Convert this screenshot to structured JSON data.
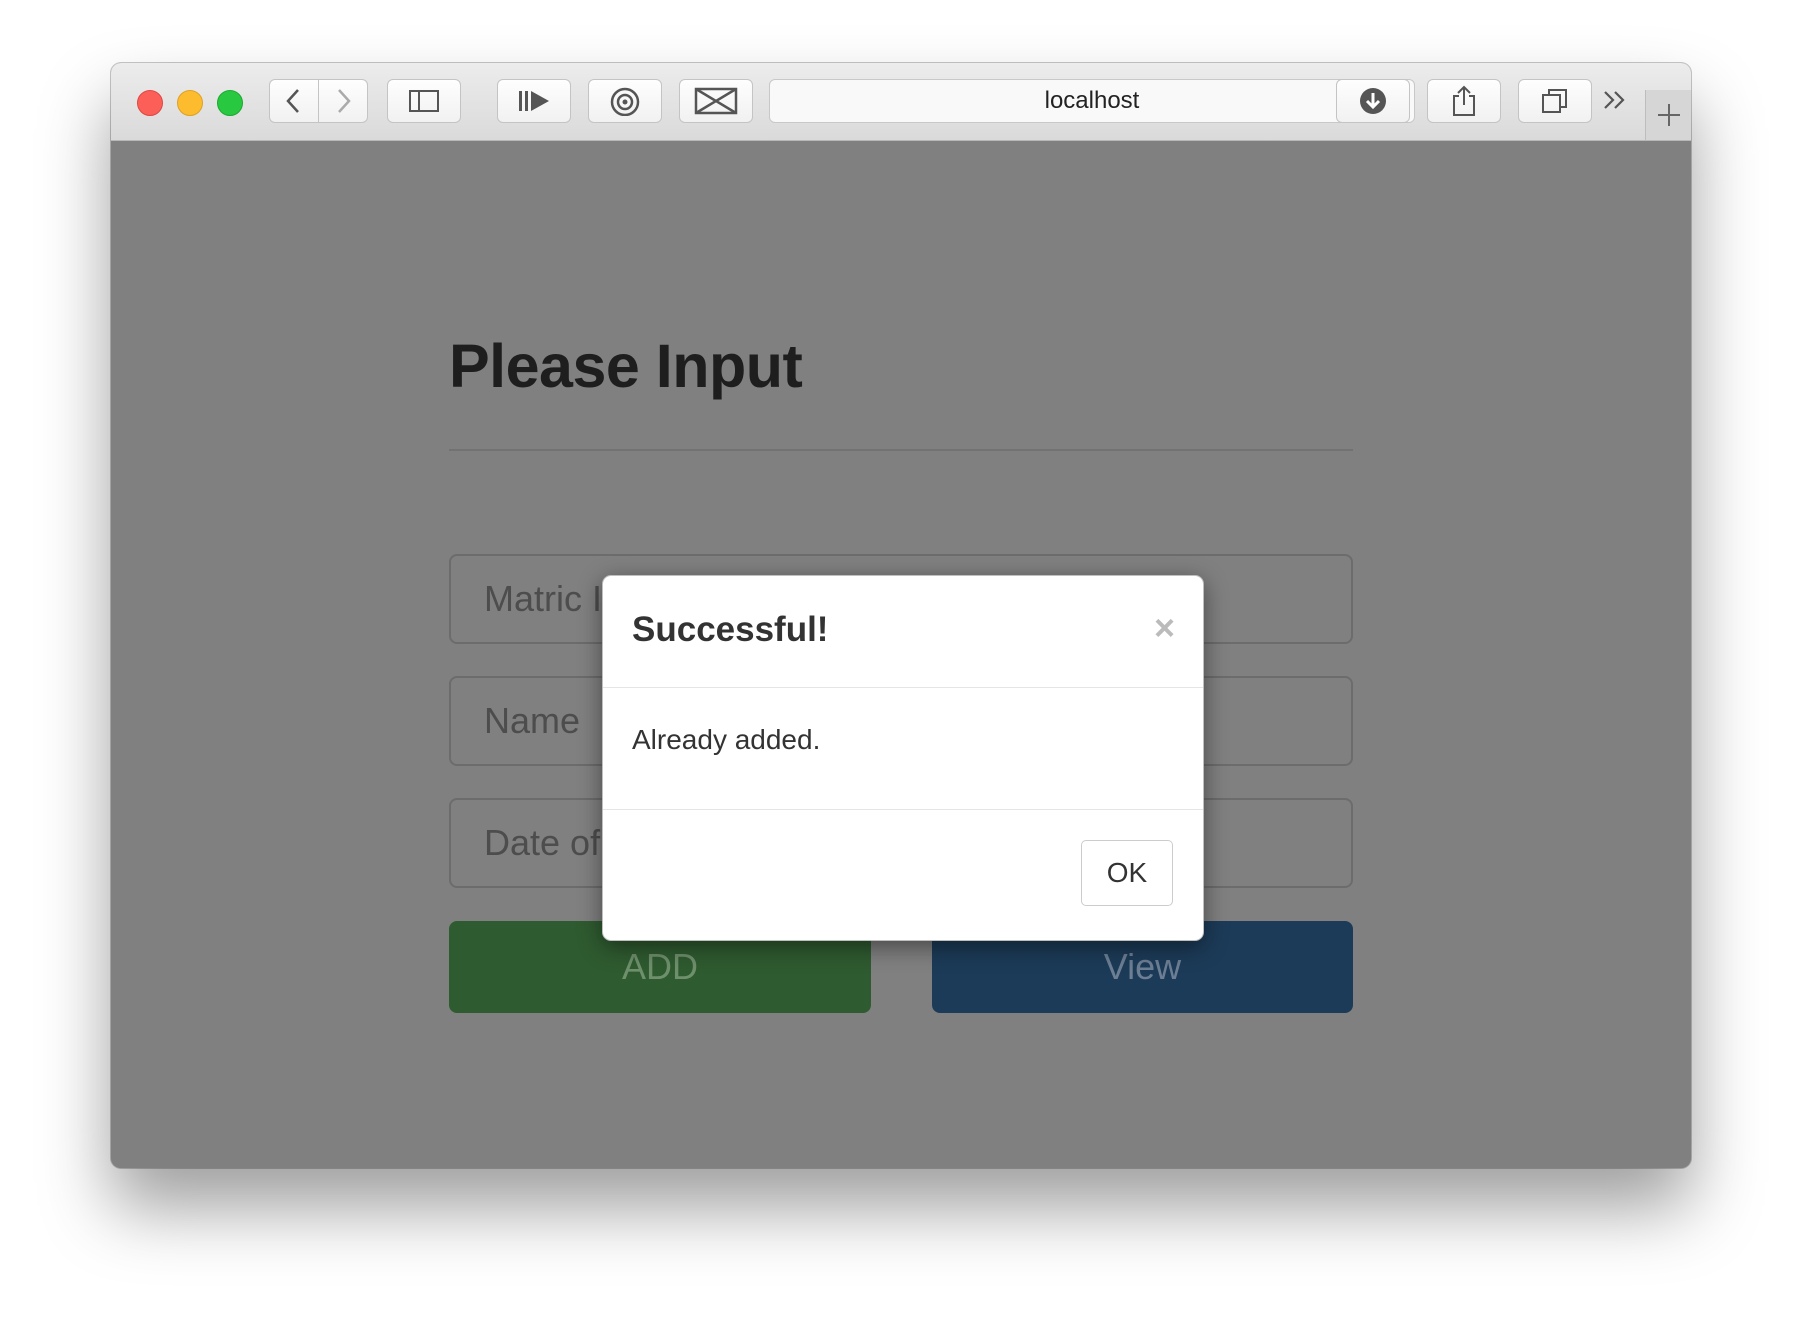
{
  "browser": {
    "url": "localhost",
    "icons": {
      "back": "chevron-left-icon",
      "forward": "chevron-right-icon",
      "sidebar": "sidebar-icon",
      "reader": "reader-play-icon",
      "wifi": "airdrop-icon",
      "bowtie": "bowtie-icon",
      "reload": "reload-icon",
      "downloads": "download-icon",
      "share": "share-icon",
      "tabs": "tabs-icon",
      "overflow": "double-chevron-icon",
      "newtab": "plus-icon"
    }
  },
  "page": {
    "title": "Please Input",
    "fields": {
      "matric_placeholder": "Matric I",
      "name_placeholder": "Name",
      "dob_placeholder": "Date of"
    },
    "buttons": {
      "add": "ADD",
      "view": "View"
    },
    "colors": {
      "add_button": "#2f5b30",
      "view_button": "#1c3b58",
      "overlay": "#808080"
    }
  },
  "modal": {
    "title": "Successful!",
    "close": "×",
    "message": "Already added.",
    "ok": "OK"
  }
}
